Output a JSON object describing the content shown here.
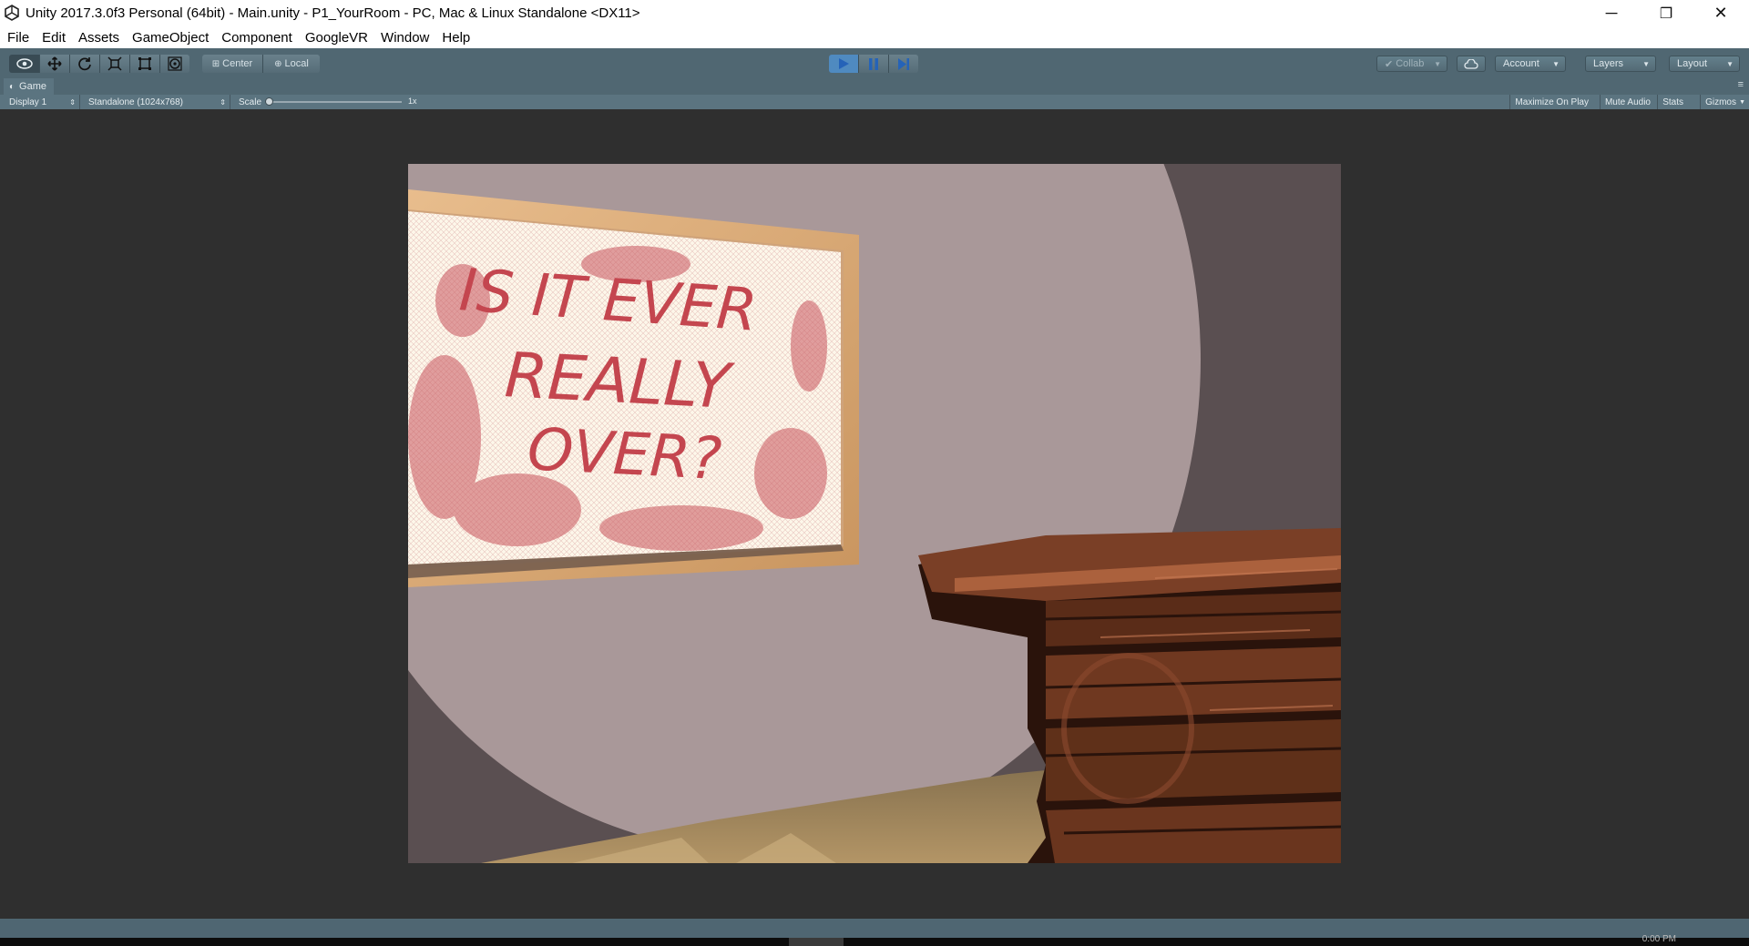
{
  "window": {
    "title": "Unity 2017.3.0f3 Personal (64bit) - Main.unity - P1_YourRoom - PC, Mac & Linux Standalone <DX11>",
    "controls": {
      "minimize": "─",
      "restore": "❐",
      "close": "✕"
    }
  },
  "menu": {
    "items": [
      "File",
      "Edit",
      "Assets",
      "GameObject",
      "Component",
      "GoogleVR",
      "Window",
      "Help"
    ]
  },
  "toolbar": {
    "pivot_label": "Center",
    "space_label": "Local",
    "collab_label": "Collab",
    "account_label": "Account",
    "layers_label": "Layers",
    "layout_label": "Layout",
    "accent_color": "#4f8ac0"
  },
  "game_tab": {
    "label": "Game",
    "display": "Display 1",
    "resolution": "Standalone (1024x768)",
    "scale_label": "Scale",
    "scale_value": "1x",
    "maximize_on_play": "Maximize On Play",
    "mute_audio": "Mute Audio",
    "stats": "Stats",
    "gizmos": "Gizmos"
  },
  "scene": {
    "mirror_text": [
      "IS IT EVER",
      "REALLY",
      "OVER?"
    ],
    "wall_color": "#a99899",
    "shadow_color": "#5a4f51",
    "frame_color": "#dcae80",
    "chest_color": "#7a3f26"
  },
  "taskbar": {
    "clock": "0:00 PM"
  }
}
